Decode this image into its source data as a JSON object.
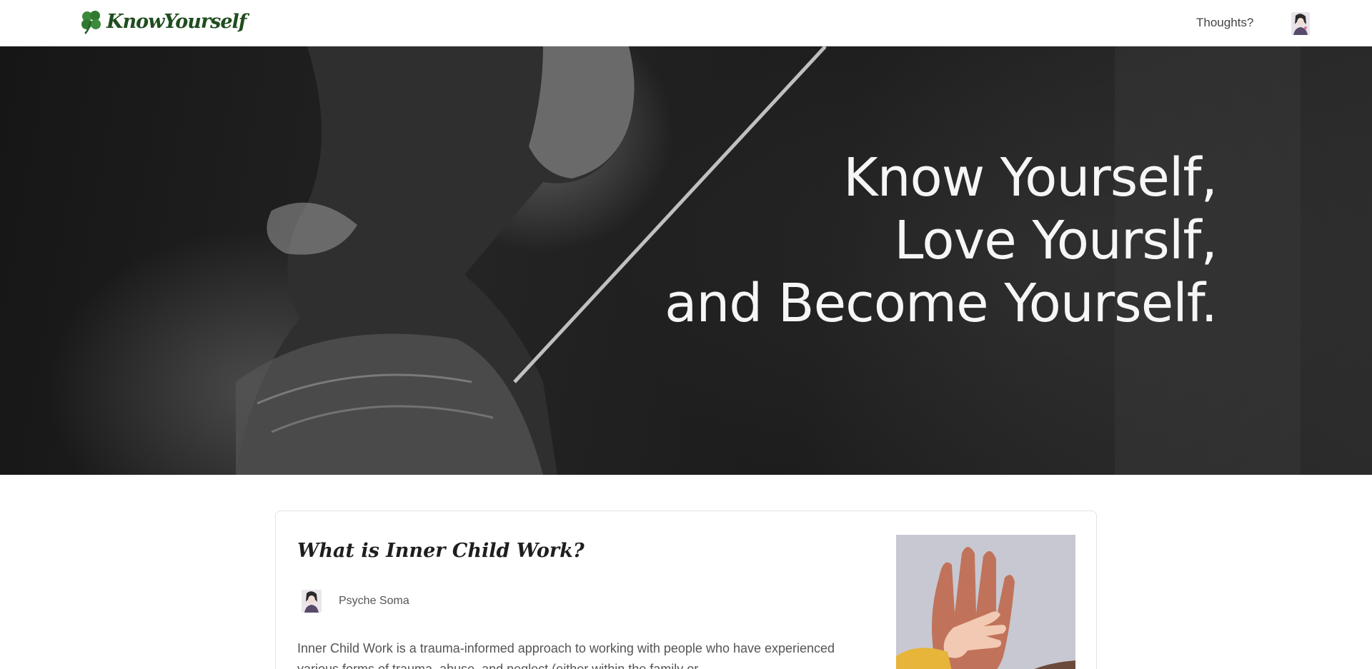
{
  "header": {
    "brand_name": "KnowYourself",
    "logo_icon": "clover-icon",
    "nav_link": "Thoughts?",
    "avatar_icon": "user-avatar-icon"
  },
  "hero": {
    "line1": "Know Yourself,",
    "line2": "Love Yourslf,",
    "line3": "and Become Yourself."
  },
  "article": {
    "title": "What is Inner Child Work?",
    "author_name": "Psyche Soma",
    "excerpt": "Inner Child Work is a trauma-informed approach to working with people who have experienced various forms of trauma, abuse, and neglect (either within the family or",
    "image_icon": "hands-photo"
  },
  "colors": {
    "brand_green": "#2e6b2e",
    "text": "#333333",
    "card_border": "#e3e3e3"
  }
}
